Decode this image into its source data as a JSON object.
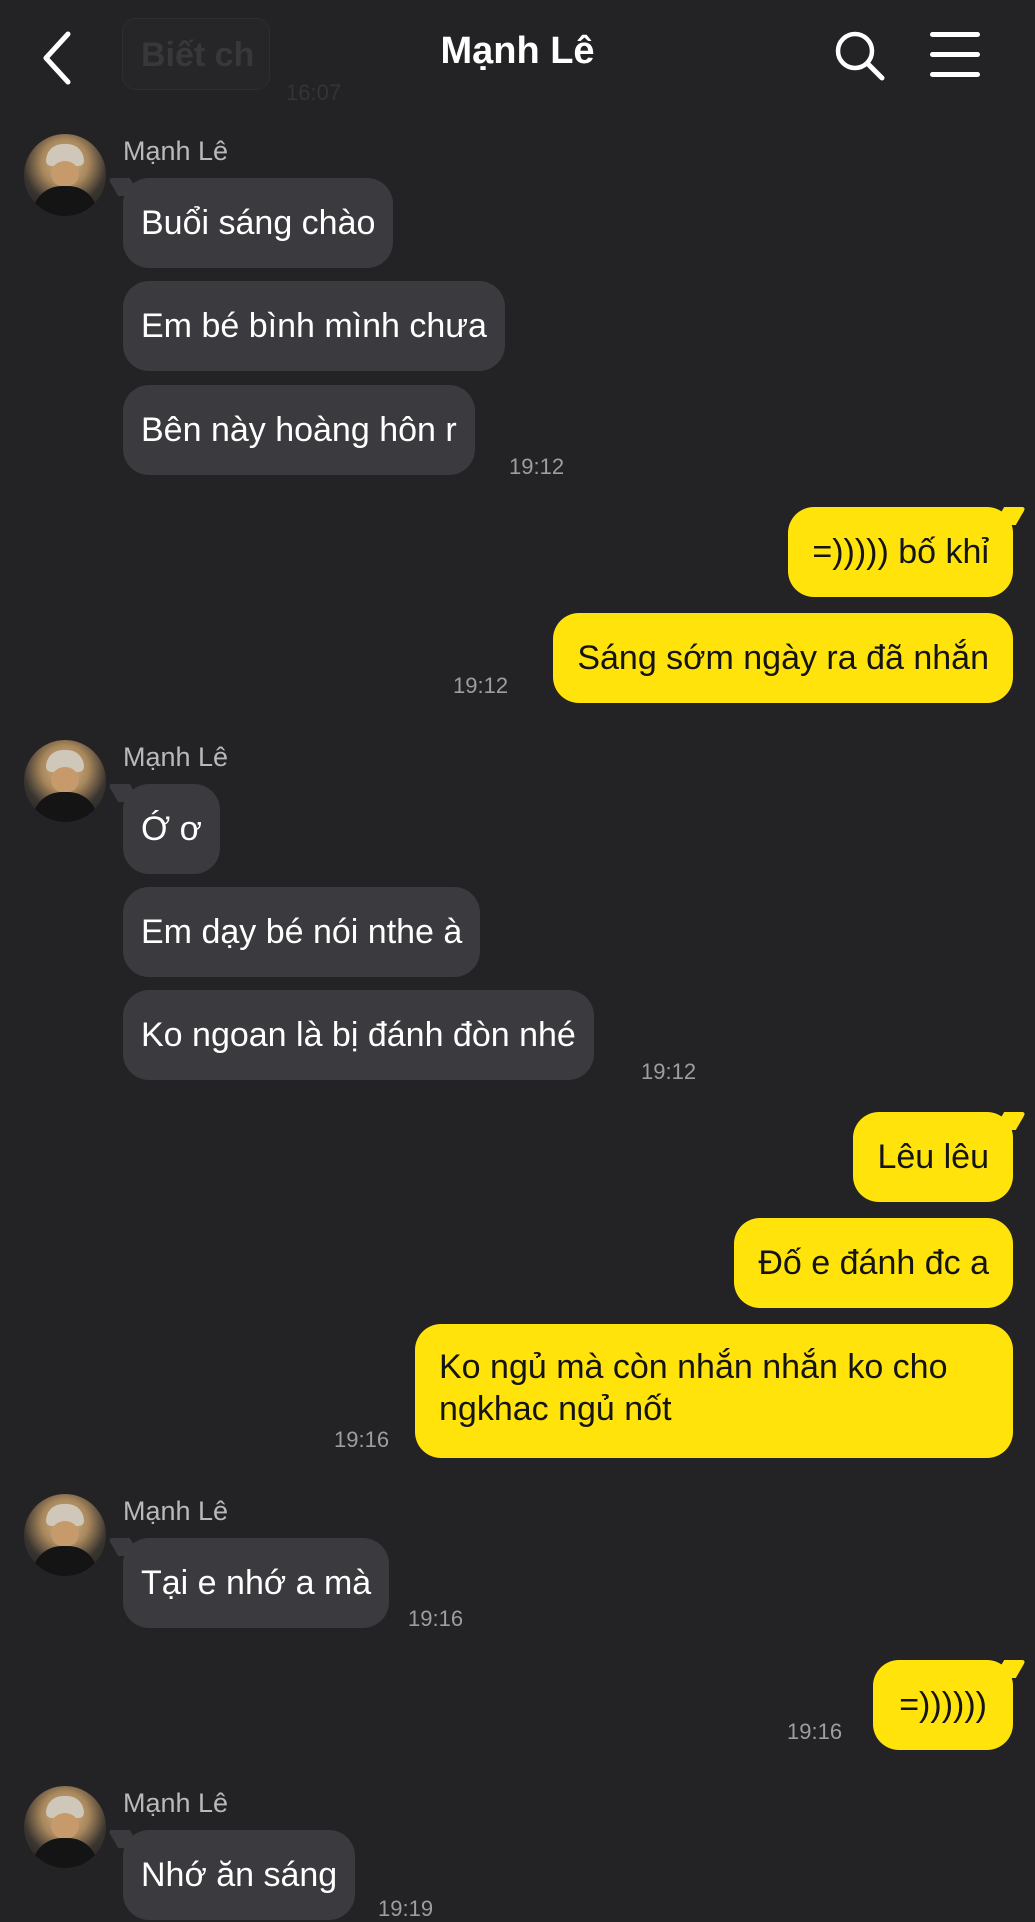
{
  "header": {
    "title": "Mạnh Lê",
    "ghost_preview": "Biết ch",
    "ghost_time": "16:07",
    "icons": [
      "back-chevron-icon",
      "search-icon",
      "menu-icon"
    ]
  },
  "colors": {
    "background": "#232325",
    "incoming_bubble": "#3b3b3f",
    "outgoing_bubble": "#ffe30a",
    "timestamp": "#9d9da2"
  },
  "messages": [
    {
      "sender": "Mạnh Lê",
      "text": "Buổi sáng chào"
    },
    {
      "text": "Em bé bình mình chưa"
    },
    {
      "text": "Bên này hoàng hôn r",
      "time": "19:12"
    },
    {
      "text": "=))))) bố khỉ"
    },
    {
      "text": "Sáng sớm ngày ra đã nhắn",
      "time": "19:12"
    },
    {
      "sender": "Mạnh Lê",
      "text": "Ớ ơ"
    },
    {
      "text": "Em dạy bé nói nthe à"
    },
    {
      "text": "Ko ngoan là bị đánh đòn nhé",
      "time": "19:12"
    },
    {
      "text": "Lêu lêu"
    },
    {
      "text": "Đố e đánh đc a"
    },
    {
      "text": "Ko ngủ mà còn nhắn nhắn ko cho ngkhac ngủ nốt",
      "time": "19:16"
    },
    {
      "sender": "Mạnh Lê",
      "text": "Tại e nhớ a mà",
      "time": "19:16"
    },
    {
      "text": "=))))))",
      "time": "19:16"
    },
    {
      "sender": "Mạnh Lê",
      "text": "Nhớ ăn sáng",
      "time": "19:19"
    }
  ]
}
